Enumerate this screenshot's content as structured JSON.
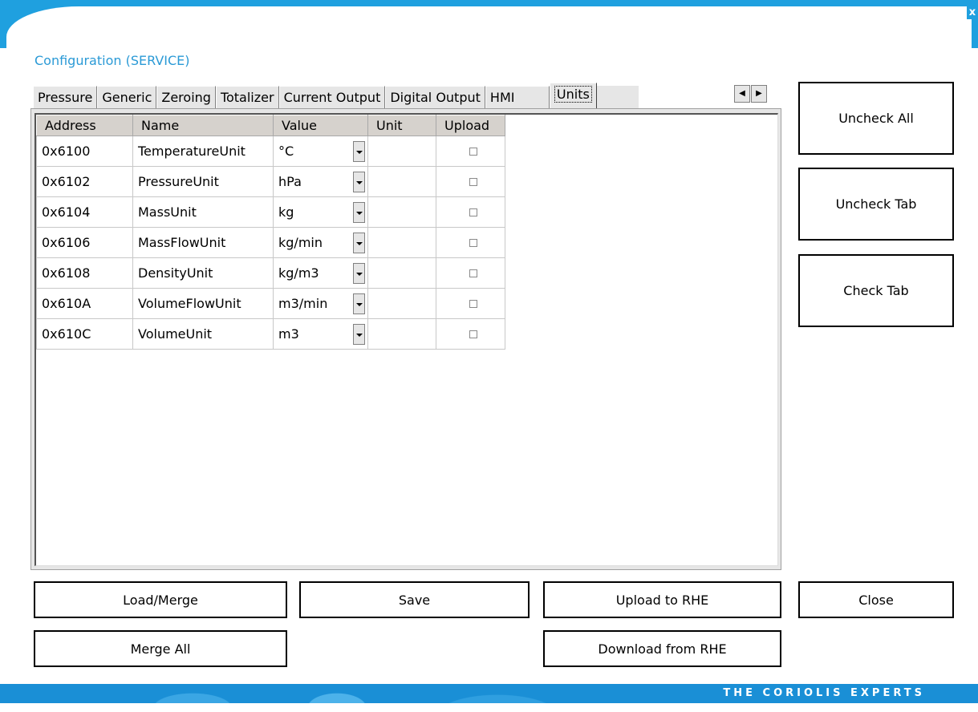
{
  "window": {
    "title": "Configuration (SERVICE)",
    "close_glyph": "x"
  },
  "tabs": [
    {
      "label": "Pressure"
    },
    {
      "label": "Generic"
    },
    {
      "label": "Zeroing"
    },
    {
      "label": "Totalizer"
    },
    {
      "label": "Current Output"
    },
    {
      "label": "Digital Output"
    },
    {
      "label": "HMI"
    },
    {
      "label": "Units",
      "active": true
    }
  ],
  "tab_scroll": {
    "left_glyph": "◀",
    "right_glyph": "▶"
  },
  "grid": {
    "headers": [
      "Address",
      "Name",
      "Value",
      "Unit",
      "Upload"
    ],
    "rows": [
      {
        "address": "0x6100",
        "name": "TemperatureUnit",
        "value": "°C",
        "unit": "",
        "upload": false
      },
      {
        "address": "0x6102",
        "name": "PressureUnit",
        "value": "hPa",
        "unit": "",
        "upload": false
      },
      {
        "address": "0x6104",
        "name": "MassUnit",
        "value": "kg",
        "unit": "",
        "upload": false
      },
      {
        "address": "0x6106",
        "name": "MassFlowUnit",
        "value": "kg/min",
        "unit": "",
        "upload": false
      },
      {
        "address": "0x6108",
        "name": "DensityUnit",
        "value": "kg/m3",
        "unit": "",
        "upload": false
      },
      {
        "address": "0x610A",
        "name": "VolumeFlowUnit",
        "value": "m3/min",
        "unit": "",
        "upload": false
      },
      {
        "address": "0x610C",
        "name": "VolumeUnit",
        "value": "m3",
        "unit": "",
        "upload": false
      }
    ]
  },
  "side_buttons": {
    "uncheck_all": "Uncheck All",
    "uncheck_tab": "Uncheck Tab",
    "check_tab": "Check Tab"
  },
  "bottom_buttons": {
    "load_merge": "Load/Merge",
    "save": "Save",
    "upload_to_rhe": "Upload to RHE",
    "close": "Close",
    "merge_all": "Merge All",
    "download_from_rhe": "Download from RHE"
  },
  "footer": {
    "tagline": "THE CORIOLIS EXPERTS"
  },
  "colors": {
    "accent": "#1fa0df",
    "title": "#2b9ad6",
    "footer": "#1a8fd6"
  }
}
